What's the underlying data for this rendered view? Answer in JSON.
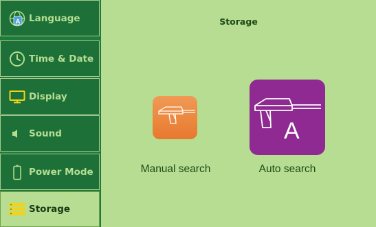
{
  "sidebar": {
    "items": [
      {
        "label": "Language",
        "icon": "language-icon"
      },
      {
        "label": "Time & Date",
        "icon": "clock-icon"
      },
      {
        "label": "Display",
        "icon": "monitor-icon"
      },
      {
        "label": "Sound",
        "icon": "speaker-icon"
      },
      {
        "label": "Power Mode",
        "icon": "battery-icon"
      },
      {
        "label": "Storage",
        "icon": "storage-icon",
        "active": true
      }
    ]
  },
  "main": {
    "title": "Storage",
    "tiles": [
      {
        "label": "Manual search",
        "icon": "detector-icon"
      },
      {
        "label": "Auto search",
        "icon": "detector-auto-icon",
        "letter": "A"
      }
    ]
  },
  "colors": {
    "background": "#b6dd92",
    "sidebar": "#1d7138",
    "manual_tile": "#e8792e",
    "auto_tile": "#8e2a91",
    "text_dark": "#1e4a16"
  }
}
